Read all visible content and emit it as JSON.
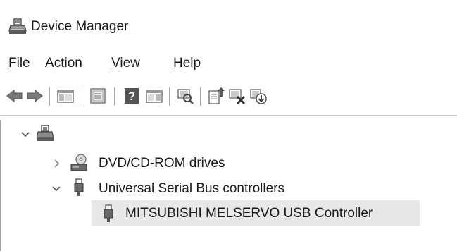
{
  "window": {
    "title": "Device Manager",
    "app_icon": "device-manager-icon"
  },
  "menu": {
    "items": [
      {
        "label_rest": "ile",
        "accelerator": "F"
      },
      {
        "label_rest": "ction",
        "accelerator": "A"
      },
      {
        "label_rest": "iew",
        "accelerator": "V"
      },
      {
        "label_rest": "elp",
        "accelerator": "H"
      }
    ]
  },
  "toolbar": {
    "buttons": [
      "back-arrow-icon",
      "forward-arrow-icon",
      "show-hide-console-tree-icon",
      "properties-icon",
      "help-icon",
      "show-hide-action-pane-icon",
      "scan-hardware-changes-icon",
      "update-driver-icon",
      "uninstall-device-icon",
      "add-legacy-hardware-icon"
    ]
  },
  "tree": {
    "root": {
      "icon": "computer-icon",
      "expanded": true
    },
    "nodes": [
      {
        "label": "DVD/CD-ROM drives",
        "icon": "dvd-drive-icon",
        "expanded": false
      },
      {
        "label": "Universal Serial Bus controllers",
        "icon": "usb-connector-icon",
        "expanded": true
      }
    ],
    "children": [
      {
        "label": "MITSUBISHI MELSERVO USB Controller",
        "icon": "usb-connector-icon",
        "selected": true
      }
    ]
  },
  "colors": {
    "selection": "#e8e8e8",
    "text": "#1a1a1a",
    "icon_gray": "#6a6a6a"
  }
}
